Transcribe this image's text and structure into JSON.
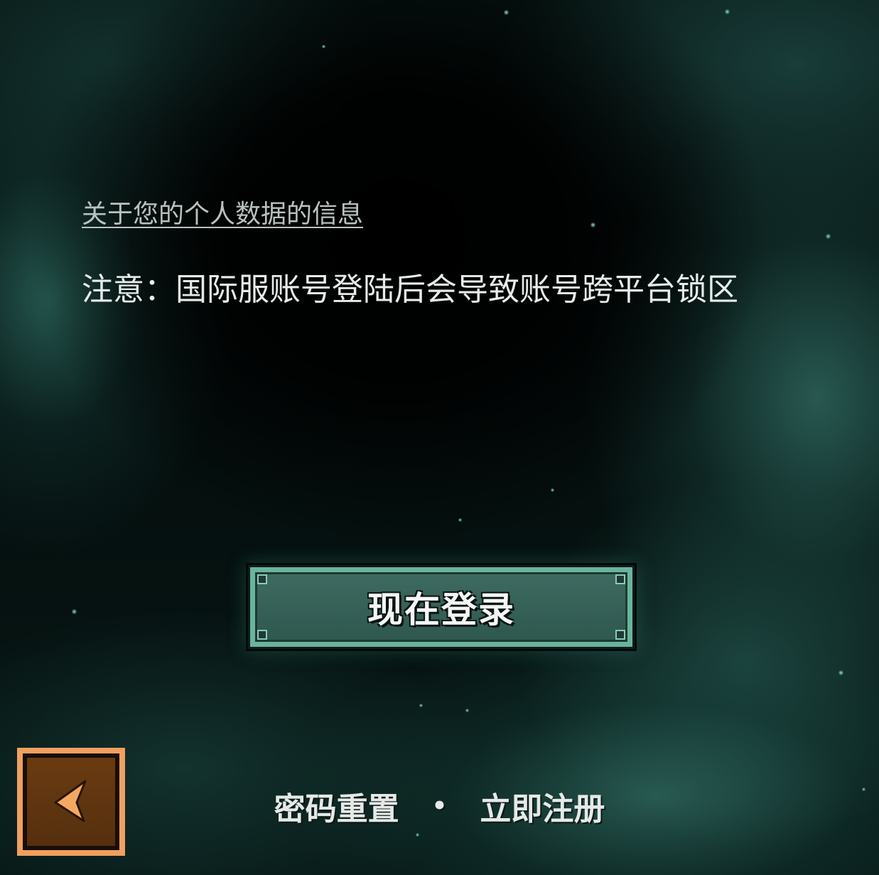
{
  "privacy_link": "关于您的个人数据的信息",
  "notice": "注意：国际服账号登陆后会导致账号跨平台锁区",
  "login_button": "现在登录",
  "bottom_links": {
    "reset_password": "密码重置",
    "separator": "•",
    "register": "立即注册"
  },
  "back_button": {
    "icon": "chevron-left-icon"
  },
  "colors": {
    "accent_teal": "#6bb39c",
    "back_orange": "#f0a060",
    "back_face": "#6a3b12"
  }
}
